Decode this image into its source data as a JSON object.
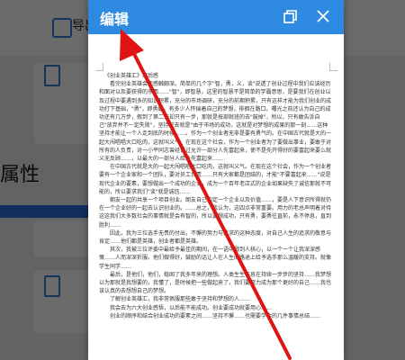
{
  "background_app": {
    "title_fragment": "导出",
    "side_text_fragment": "属性"
  },
  "modal": {
    "title": "编辑",
    "restore_icon": "restore-window-icon",
    "close_icon": "close-icon"
  },
  "document": {
    "heading": "《创业英雄汇》观后感",
    "paragraphs": [
      "看完创业英雄会我感触颇深。简单的几个字\"智，勇，义，谈\"说透了创业过程中我们应该经历和面对以及要获得的东西……\"智\"，即智慧，这里的智慧不是简单的学霸意思，是要我们在创业以及过程中要遇到多的知识积累，充分的市场调研，充分的前期积累，只有这样才能为我们创业的成功打下基础，\"勇\"，即勇敢，有多少人怀揣着自己的梦想，徘徊在路口。曙光之前还认为自己的成功还有几万步，假到了第二天却只有一步，那就是按部就班的去\"鼓掉\"，所以，只有敢告诉自己\"放弃并不一定失败\"，坚持过去就是\"由于市场的成功，这就是对梦想的成果的那一刻……这种坚持才能让一个人走到底的时候……。作为一个创业者无非是要有勇气的。在中国古代就是大的一起大闯唱唱大口吃肉，这就叫义气，在现在这个社会，作为一个创业者为了要做出事业，要敢于对所有的人负责，对一小平同志曾经说过允许一部分人先富起来，使不是先开得好的要富起来要么就义无反顾……，以最大的一部分人给外先富起来……",
      "在中国古代就是大的一起大闯唱唱大口吃肉，这就叫义气。在现在这个社会，作为一个创业者要有一个企业家和一个团队，要对员工负责……只有大家都是团结的，才能\"不要富起来……\"说是现代企业的要素，要想做出一个成功的企业，成为一个百年老店式的企业如果缺失了诚信那就不可能的，所以要求我们\"谈\"就是诚信……",
      "朝友一起的共享一个项目创业。朗友自己的定一个企业以及价值……，要是人下意识所得就仍在一个企业好的一起去认识创业的。……总之，我认为，这四点非常重要。用力的老总声明着对待这这我们大多数社会的事情就是会有智的，所以要想成功，只有勇，要勇往直前，永不停息，直到胜利……",
      "因此，我为三位选手无畏的付出，不懈的努力与追求的这种态度，对自己人生的追求的敬意与肯定……他们都是英雄，创业者都是英雄。",
      "其次，我被三位评委中最给予最佳的期间，在一语中戳到人核心，以一个一个让我深深感慨……人而深深折服。他们做得好，鼓励的话让人在人生的路途上给予选手那么温暖的支持。就像学生同学……",
      "最后，是他们，他们，稳固了我多年来的理想。人类生生不息在持续一步步的坚持……我梦想以为那就是我想要的，我懂了，是时候把一些做起来了，我们要努力成为那个更好的自己……我也该认真的去想想自己的梦想。",
      "了解创业英雄汇，我非常佩服那些敢于坚持和梦想的人……",
      "我会去为六大创业感悟，以后能不能成功。创业要成功就要用心……",
      "创业的顺序和结合创业成功的要素之间……坚持不懈……也需要学会的几件事情总结……"
    ]
  }
}
